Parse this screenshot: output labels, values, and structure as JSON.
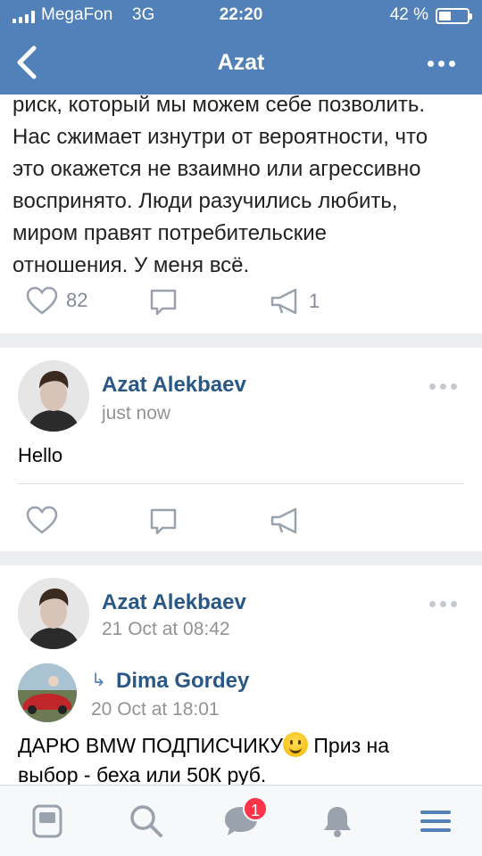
{
  "status_bar": {
    "carrier": "MegaFon",
    "network": "3G",
    "time": "22:20",
    "battery_percent": "42 %",
    "battery_level": 0.42
  },
  "nav": {
    "title": "Azat",
    "back_icon": "chevron-left-icon",
    "menu_icon": "more-horizontal-icon"
  },
  "posts": [
    {
      "text": "риск, который мы можем себе позволить.\nНас сжимает изнутри от вероятности, что\nэто окажется не взаимно или агрессивно\nвоспринято. Люди разучились любить,\nмиром правят потребительские\nотношения. У меня всё.",
      "likes": "82",
      "comments": "",
      "shares": "1"
    },
    {
      "author": "Azat Alekbaev",
      "time": "just now",
      "text": "Hello",
      "likes": "",
      "comments": "",
      "shares": ""
    },
    {
      "author": "Azat Alekbaev",
      "time": "21 Oct at 08:42",
      "repost": {
        "author": "Dima Gordey",
        "time": "20 Oct at 18:01",
        "text_before_emoji": "ДАРЮ BMW ПОДПИСЧИКУ",
        "text_after_emoji": " Приз на",
        "text_line2": "выбор - беха или 50К руб."
      }
    }
  ],
  "tabbar": {
    "items": [
      "news-icon",
      "search-icon",
      "messages-icon",
      "notifications-icon",
      "menu-icon"
    ],
    "messages_badge": "1"
  },
  "colors": {
    "header_blue": "#5181b8",
    "link_blue": "#2a5885",
    "badge_red": "#ff3347"
  }
}
